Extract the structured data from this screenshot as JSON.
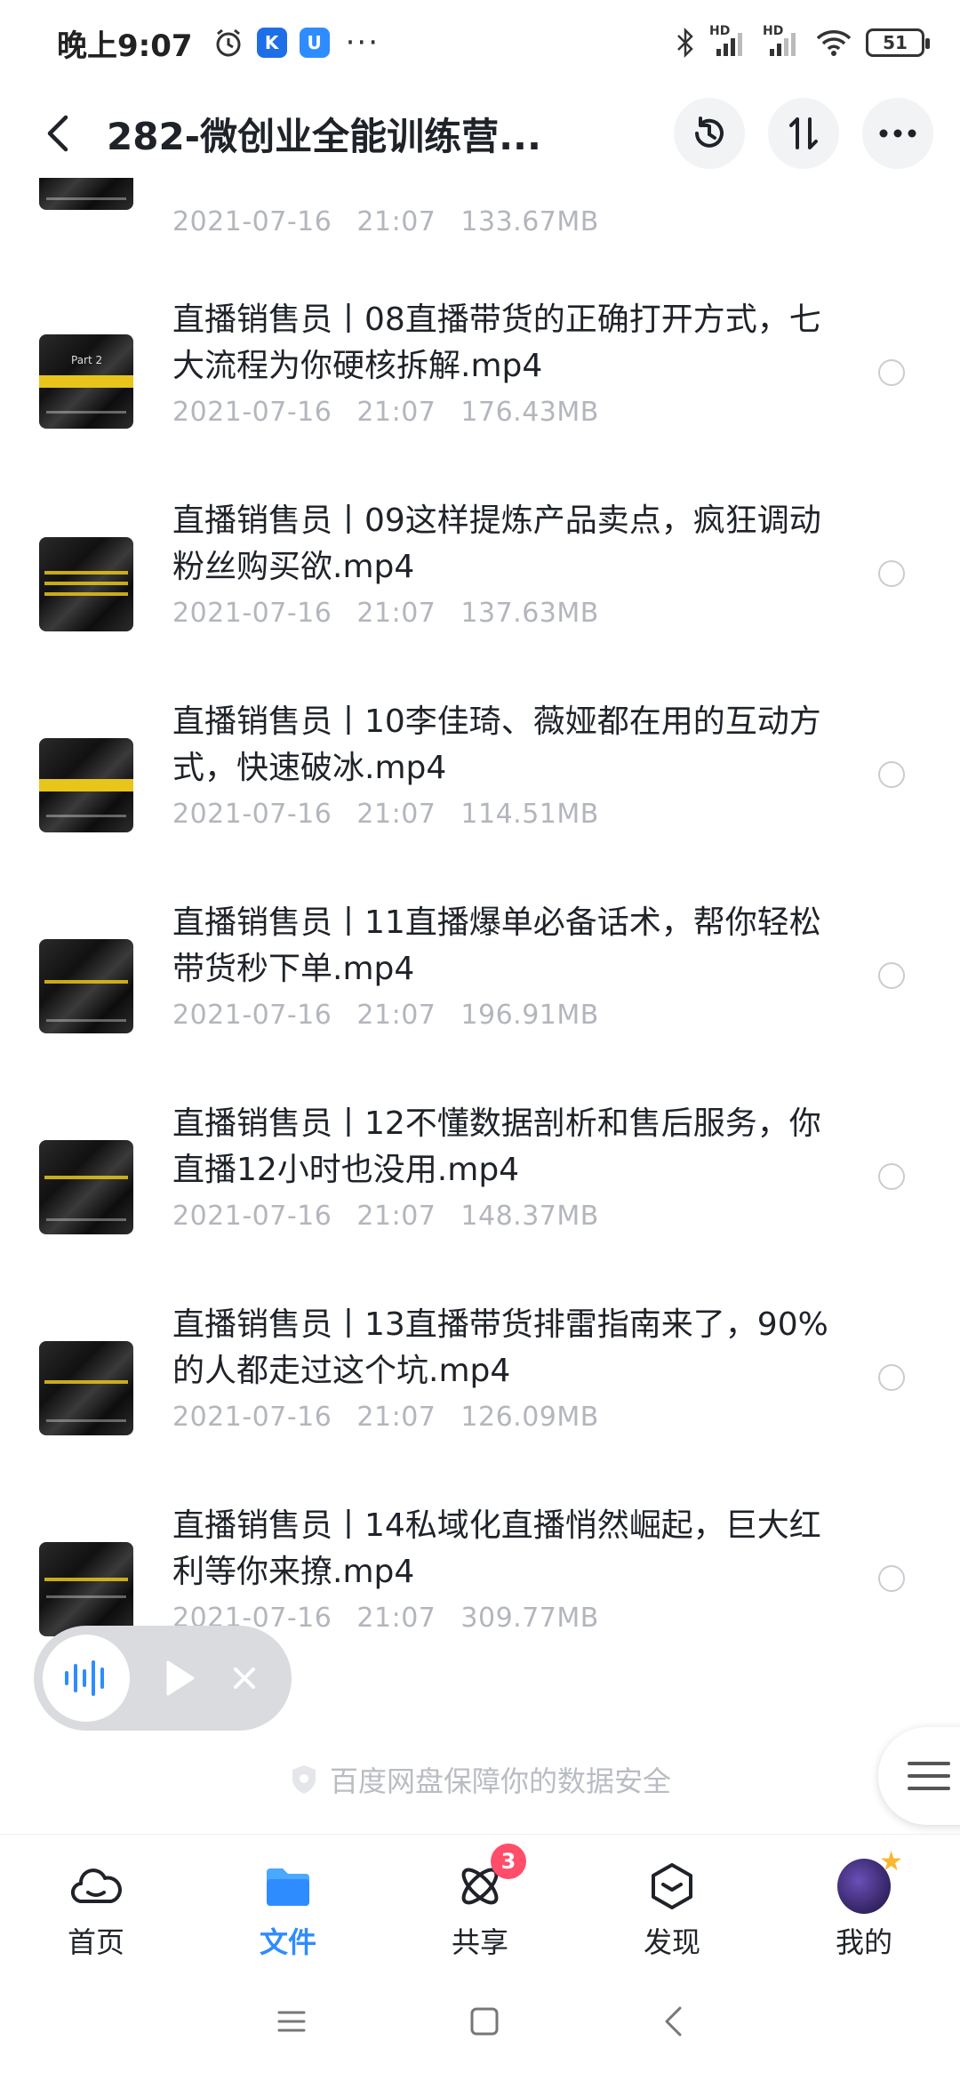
{
  "status_bar": {
    "time": "晚上9:07",
    "app_icon_1": "K",
    "app_icon_2": "U",
    "dots": "···",
    "signal_1": "HD",
    "signal_2": "HD",
    "battery": "51"
  },
  "header": {
    "title": "282-微创业全能训练营...",
    "icons": [
      "back-icon",
      "history-icon",
      "sort-icon",
      "more-icon"
    ]
  },
  "files": [
    {
      "name": "",
      "date": "2021-07-16",
      "time": "21:07",
      "size": "133.67MB"
    },
    {
      "name": "直播销售员丨08直播带货的正确打开方式，七大流程为你硬核拆解.mp4",
      "date": "2021-07-16",
      "time": "21:07",
      "size": "176.43MB",
      "thumb_text": "Part 2"
    },
    {
      "name": "直播销售员丨09这样提炼产品卖点，疯狂调动粉丝购买欲.mp4",
      "date": "2021-07-16",
      "time": "21:07",
      "size": "137.63MB"
    },
    {
      "name": "直播销售员丨10李佳琦、薇娅都在用的互动方式，快速破冰.mp4",
      "date": "2021-07-16",
      "time": "21:07",
      "size": "114.51MB"
    },
    {
      "name": "直播销售员丨11直播爆单必备话术，帮你轻松带货秒下单.mp4",
      "date": "2021-07-16",
      "time": "21:07",
      "size": "196.91MB"
    },
    {
      "name": "直播销售员丨12不懂数据剖析和售后服务，你直播12小时也没用.mp4",
      "date": "2021-07-16",
      "time": "21:07",
      "size": "148.37MB"
    },
    {
      "name": "直播销售员丨13直播带货排雷指南来了，90%的人都走过这个坑.mp4",
      "date": "2021-07-16",
      "time": "21:07",
      "size": "126.09MB"
    },
    {
      "name": "直播销售员丨14私域化直播悄然崛起，巨大红利等你来撩.mp4",
      "date": "2021-07-16",
      "time": "21:07",
      "size": "309.77MB"
    }
  ],
  "security_note": "百度网盘保障你的数据安全",
  "bottom_nav": [
    {
      "label": "首页",
      "icon": "home-icon"
    },
    {
      "label": "文件",
      "icon": "folder-icon",
      "active": true
    },
    {
      "label": "共享",
      "icon": "share-icon",
      "badge": "3"
    },
    {
      "label": "发现",
      "icon": "discover-icon"
    },
    {
      "label": "我的",
      "icon": "avatar"
    }
  ],
  "colors": {
    "accent": "#2f8cff",
    "badge": "#ff4d6a",
    "meta": "#b3b6bc"
  }
}
